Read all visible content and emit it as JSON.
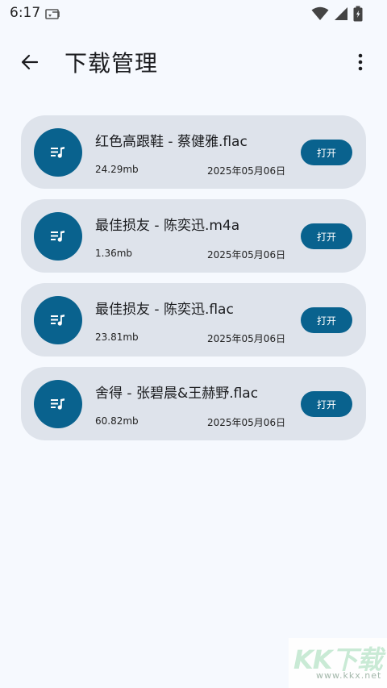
{
  "status_bar": {
    "time": "6:17"
  },
  "header": {
    "title": "下载管理"
  },
  "downloads": [
    {
      "name": "红色高跟鞋 - 蔡健雅.flac",
      "size": "24.29mb",
      "date": "2025年05月06日",
      "action": "打开"
    },
    {
      "name": "最佳损友 - 陈奕迅.m4a",
      "size": "1.36mb",
      "date": "2025年05月06日",
      "action": "打开"
    },
    {
      "name": "最佳损友 - 陈奕迅.flac",
      "size": "23.81mb",
      "date": "2025年05月06日",
      "action": "打开"
    },
    {
      "name": "舍得 - 张碧晨&王赫野.flac",
      "size": "60.82mb",
      "date": "2025年05月06日",
      "action": "打开"
    }
  ],
  "watermark": {
    "main": "KK下载",
    "sub": "www.kkx.net"
  },
  "icons": {
    "back": "arrow-left-icon",
    "more": "more-vertical-icon",
    "track": "playlist-music-icon",
    "wifi": "wifi-icon",
    "signal": "signal-icon",
    "battery": "battery-icon",
    "sim": "sim-card-icon"
  },
  "colors": {
    "accent": "#09628e",
    "card_bg": "#dee3eb",
    "page_bg": "#f6f9fe"
  }
}
